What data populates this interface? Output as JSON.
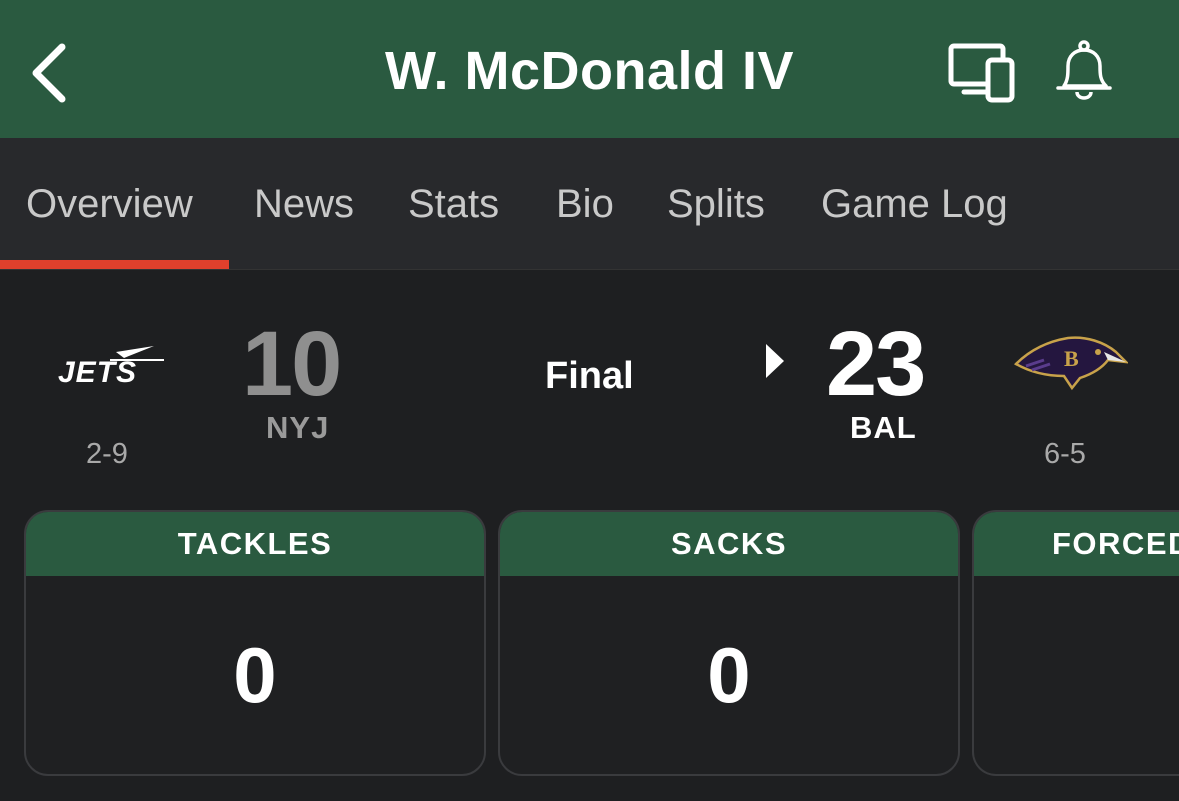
{
  "header": {
    "title": "W. McDonald IV",
    "background": "#2a5a40",
    "back_icon": "chevron-left-icon",
    "devices_icon": "devices-icon",
    "bell_icon": "bell-icon"
  },
  "tabs": [
    {
      "label": "Overview",
      "active": true
    },
    {
      "label": "News",
      "active": false
    },
    {
      "label": "Stats",
      "active": false
    },
    {
      "label": "Bio",
      "active": false
    },
    {
      "label": "Splits",
      "active": false
    },
    {
      "label": "Game Log",
      "active": false
    }
  ],
  "accent_color": "#e0402c",
  "game": {
    "status": "Final",
    "away": {
      "logo_text": "JETS",
      "score": "10",
      "abbr": "NYJ",
      "record": "2-9",
      "winner": false
    },
    "home": {
      "logo": "ravens-logo",
      "score": "23",
      "abbr": "BAL",
      "record": "6-5",
      "winner": true
    }
  },
  "stats": [
    {
      "label": "TACKLES",
      "value": "0"
    },
    {
      "label": "SACKS",
      "value": "0"
    },
    {
      "label": "FORCED",
      "value": ""
    }
  ]
}
